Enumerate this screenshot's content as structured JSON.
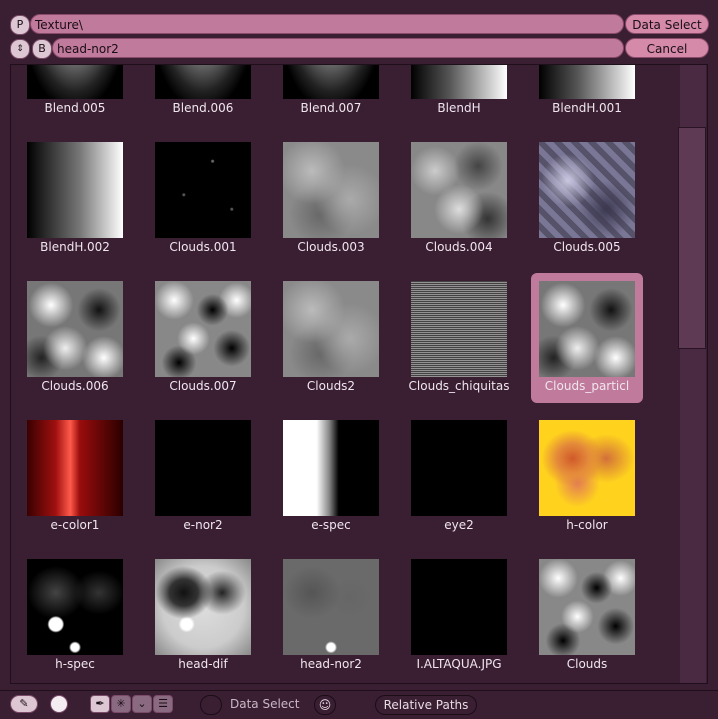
{
  "header": {
    "path_tab": "P",
    "path_value": "Texture\\",
    "data_select_button": "Data Select",
    "browse_tab": "B",
    "name_value": "head-nor2",
    "cancel_button": "Cancel"
  },
  "items": [
    {
      "label": "Blend.005",
      "kind": "radial-cut"
    },
    {
      "label": "Blend.006",
      "kind": "radial-cut"
    },
    {
      "label": "Blend.007",
      "kind": "radial-cut"
    },
    {
      "label": "BlendH",
      "kind": "hgrad-cut"
    },
    {
      "label": "BlendH.001",
      "kind": "hgrad-cut"
    },
    {
      "label": "BlendH.002",
      "kind": "hgrad"
    },
    {
      "label": "Clouds.001",
      "kind": "dark-dots"
    },
    {
      "label": "Clouds.003",
      "kind": "soft-clouds"
    },
    {
      "label": "Clouds.004",
      "kind": "clouds"
    },
    {
      "label": "Clouds.005",
      "kind": "purple-noise"
    },
    {
      "label": "Clouds.006",
      "kind": "contrast-clouds"
    },
    {
      "label": "Clouds.007",
      "kind": "hard-clouds"
    },
    {
      "label": "Clouds2",
      "kind": "soft-clouds"
    },
    {
      "label": "Clouds_chiquitas",
      "kind": "fine-noise"
    },
    {
      "label": "Clouds_particl",
      "kind": "contrast-clouds",
      "selected": true
    },
    {
      "label": "e-color1",
      "kind": "red"
    },
    {
      "label": "e-nor2",
      "kind": "black"
    },
    {
      "label": "e-spec",
      "kind": "white-left"
    },
    {
      "label": "eye2",
      "kind": "black"
    },
    {
      "label": "h-color",
      "kind": "yellow"
    },
    {
      "label": "h-spec",
      "kind": "spec"
    },
    {
      "label": "head-dif",
      "kind": "headdif"
    },
    {
      "label": "head-nor2",
      "kind": "headnor"
    },
    {
      "label": "I.ALTAQUA.JPG",
      "kind": "black"
    },
    {
      "label": "Clouds",
      "kind": "hard-clouds"
    }
  ],
  "footer": {
    "data_select_label": "Data Select",
    "relative_paths_button": "Relative Paths"
  }
}
